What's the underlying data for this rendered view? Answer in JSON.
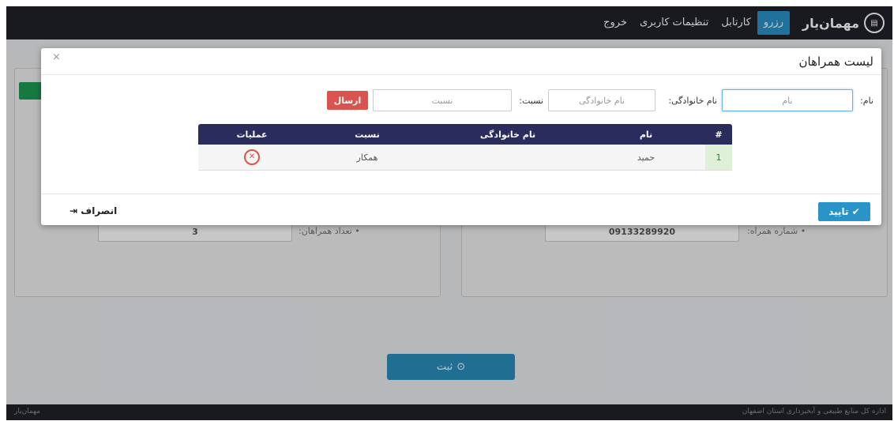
{
  "navbar": {
    "brand": "مهمان‌یار",
    "items": [
      {
        "label": "رزرو",
        "active": true
      },
      {
        "label": "کارتابل",
        "active": false
      },
      {
        "label": "تنظیمات کاربری",
        "active": false
      },
      {
        "label": "خروج",
        "active": false
      }
    ]
  },
  "background": {
    "phone_label": "• شماره همراه:",
    "phone_value": "09133289920",
    "companions_label": "• تعداد همراهان:",
    "companions_value": "3",
    "submit_label": "ثبت"
  },
  "footer": {
    "right_text": "اداره کل منابع طبیعی و آبخیزداری استان اصفهان",
    "left_text": "مهمان‌یار"
  },
  "modal": {
    "title": "لیست همراهان",
    "form": {
      "name_label": "نام:",
      "name_placeholder": "نام",
      "family_label": "نام خانوادگی:",
      "family_placeholder": "نام خانوادگی",
      "relation_label": "نسبت:",
      "relation_placeholder": "نسبت",
      "send_label": "ارسال"
    },
    "table": {
      "headers": [
        "#",
        "نام",
        "نام خانوادگی",
        "نسبت",
        "عملیات"
      ],
      "rows": [
        {
          "index": "1",
          "name": "حمید",
          "family": "",
          "relation": "همکار"
        }
      ]
    },
    "confirm_label": "✔ تایید",
    "cancel_label": "انصراف"
  },
  "colors": {
    "navbar": "#20202a",
    "accent": "#2a93c9",
    "table_header": "#2a2c5e",
    "danger": "#d9534f"
  }
}
